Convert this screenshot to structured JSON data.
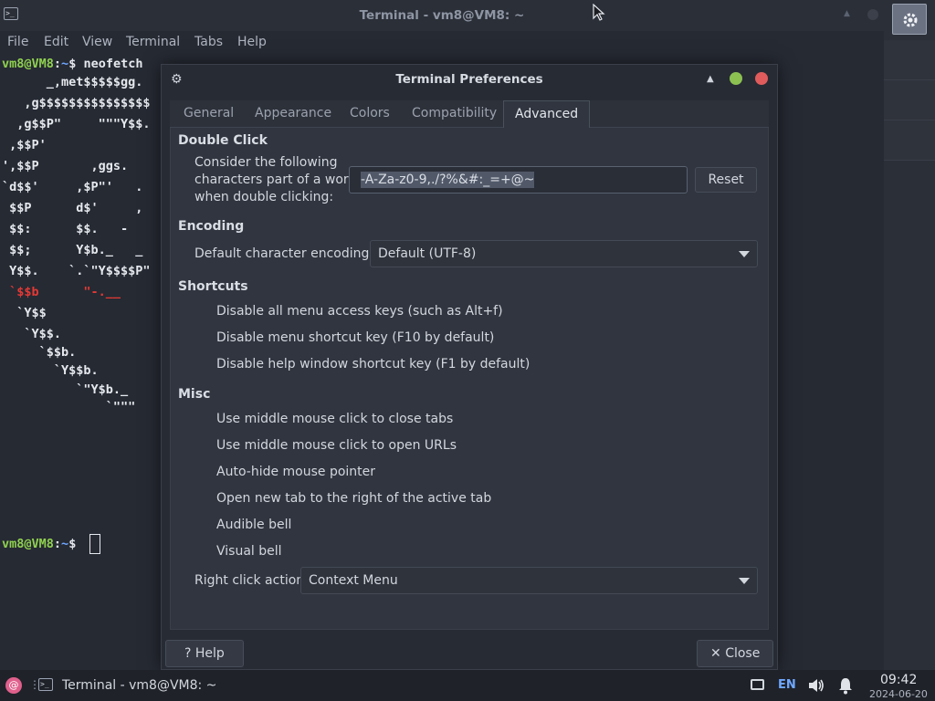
{
  "terminal": {
    "title": "Terminal - vm8@VM8: ~",
    "menu": [
      "File",
      "Edit",
      "View",
      "Terminal",
      "Tabs",
      "Help"
    ],
    "prompt_user": "vm8@VM8",
    "prompt_sep": ":",
    "prompt_path": "~",
    "prompt_dollar": "$",
    "command": "neofetch",
    "ascii": [
      "      _,met$$$$$gg.",
      "   ,g$$$$$$$$$$$$$$$",
      "  ,g$$P\"     \"\"\"Y$$.",
      " ,$$P'",
      "',$$P       ,ggs.",
      "`d$$'     ,$P\"'   .",
      " $$P      d$'     ,",
      " $$:      $$.   -",
      " $$;      Y$b._   _",
      " Y$$.    `.`\"Y$$$$P\"",
      " `$$b      \"-.__",
      "  `Y$$",
      "   `Y$$.",
      "     `$$b.",
      "       `Y$$b.",
      "          `\"Y$b._",
      "              `\"\"\""
    ]
  },
  "prefs": {
    "title": "Terminal Preferences",
    "tabs": [
      "General",
      "Appearance",
      "Colors",
      "Compatibility",
      "Advanced"
    ],
    "active_tab": "Advanced",
    "double_click": {
      "heading": "Double Click",
      "label_lines": [
        "Consider the following",
        "characters part of a word",
        "when double clicking:"
      ],
      "value": "-A-Za-z0-9,./?%&#:_=+@~",
      "reset_label": "Reset"
    },
    "encoding": {
      "heading": "Encoding",
      "label": "Default character encoding:",
      "value": "Default (UTF-8)"
    },
    "shortcuts": {
      "heading": "Shortcuts",
      "options": [
        "Disable all menu access keys (such as Alt+f)",
        "Disable menu shortcut key (F10 by default)",
        "Disable help window shortcut key (F1 by default)"
      ]
    },
    "misc": {
      "heading": "Misc",
      "options": [
        "Use middle mouse click to close tabs",
        "Use middle mouse click to open URLs",
        "Auto-hide mouse pointer",
        "Open new tab to the right of the active tab",
        "Audible bell",
        "Visual bell"
      ],
      "right_click_label": "Right click action:",
      "right_click_value": "Context Menu"
    },
    "help_label": "Help",
    "close_label": "Close"
  },
  "taskbar": {
    "task_title": "Terminal - vm8@VM8: ~",
    "lang": "EN",
    "time": "09:42",
    "date": "2024-06-20"
  },
  "icons": {
    "start": "debian-swirl-icon",
    "terminal": "terminal-icon",
    "network": "network-icon",
    "volume": "volume-icon",
    "notifications": "bell-icon",
    "settings": "gear-icon"
  }
}
